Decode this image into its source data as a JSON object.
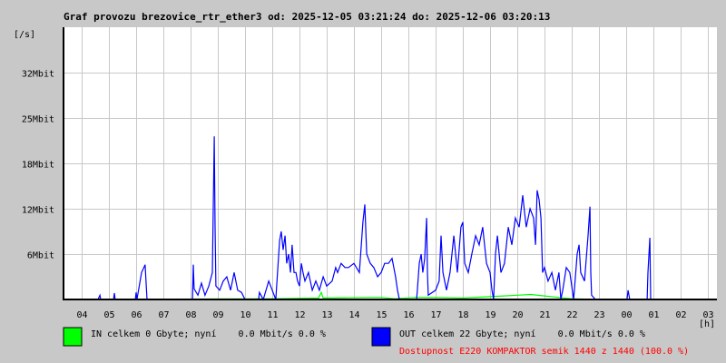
{
  "chart_data": {
    "type": "line",
    "title": "Graf provozu brezovice_rtr_ether3 od: 2025-12-05 03:21:24 do: 2025-12-06 03:20:13",
    "ylabel": "[/s]",
    "xlabel": "[h]",
    "ytick_labels": [
      "6Mbit",
      "12Mbit",
      "18Mbit",
      "25Mbit",
      "32Mbit"
    ],
    "ytick_values": [
      6.4,
      12.8,
      19.2,
      25.6,
      32.0
    ],
    "ylim": [
      0,
      38.4
    ],
    "xtick_labels": [
      "04",
      "05",
      "06",
      "07",
      "08",
      "09",
      "10",
      "11",
      "12",
      "13",
      "14",
      "15",
      "16",
      "17",
      "18",
      "19",
      "20",
      "21",
      "22",
      "23",
      "00",
      "01",
      "02",
      "03"
    ],
    "xtick_values": [
      4,
      5,
      6,
      7,
      8,
      9,
      10,
      11,
      12,
      13,
      14,
      15,
      16,
      17,
      18,
      19,
      20,
      21,
      22,
      23,
      24,
      25,
      26,
      27
    ],
    "xlim": [
      3.333,
      27.333
    ],
    "grid": true,
    "series": [
      {
        "name": "IN",
        "color": "#00ff00",
        "points": [
          [
            3.35,
            0
          ],
          [
            11,
            0.1
          ],
          [
            12.7,
            0.2
          ],
          [
            12.8,
            1.0
          ],
          [
            12.87,
            0.2
          ],
          [
            14.5,
            0.3
          ],
          [
            15,
            0.3
          ],
          [
            15.5,
            0.1
          ],
          [
            16.3,
            0.3
          ],
          [
            17,
            0.3
          ],
          [
            18,
            0.2
          ],
          [
            19,
            0.4
          ],
          [
            19.5,
            0.5
          ],
          [
            20,
            0.6
          ],
          [
            20.5,
            0.7
          ],
          [
            21,
            0.5
          ],
          [
            21.5,
            0.3
          ],
          [
            22,
            0.1
          ],
          [
            23,
            0
          ]
        ]
      },
      {
        "name": "OUT",
        "color": "#0000ff",
        "points": [
          [
            3.35,
            0
          ],
          [
            4.6,
            0
          ],
          [
            4.67,
            0.6
          ],
          [
            4.7,
            0
          ],
          [
            5.17,
            0
          ],
          [
            5.2,
            0.9
          ],
          [
            5.23,
            0
          ],
          [
            5.97,
            0
          ],
          [
            6.0,
            1.0
          ],
          [
            6.03,
            0
          ],
          [
            6.2,
            3.8
          ],
          [
            6.33,
            4.9
          ],
          [
            6.4,
            0
          ],
          [
            8.07,
            0
          ],
          [
            8.1,
            4.9
          ],
          [
            8.13,
            1.5
          ],
          [
            8.27,
            0.6
          ],
          [
            8.4,
            2.3
          ],
          [
            8.53,
            0.6
          ],
          [
            8.67,
            1.9
          ],
          [
            8.8,
            3.8
          ],
          [
            8.87,
            23.0
          ],
          [
            8.9,
            10.2
          ],
          [
            8.93,
            1.9
          ],
          [
            9.07,
            1.3
          ],
          [
            9.2,
            2.6
          ],
          [
            9.33,
            3.2
          ],
          [
            9.47,
            1.3
          ],
          [
            9.6,
            3.8
          ],
          [
            9.73,
            1.3
          ],
          [
            9.87,
            1.0
          ],
          [
            10.0,
            0
          ],
          [
            10.5,
            0
          ],
          [
            10.53,
            1.0
          ],
          [
            10.67,
            0
          ],
          [
            10.87,
            2.6
          ],
          [
            11.0,
            1.3
          ],
          [
            11.13,
            0
          ],
          [
            11.27,
            8.3
          ],
          [
            11.33,
            9.6
          ],
          [
            11.4,
            7.0
          ],
          [
            11.47,
            9.0
          ],
          [
            11.53,
            5.1
          ],
          [
            11.6,
            6.4
          ],
          [
            11.67,
            3.8
          ],
          [
            11.73,
            7.7
          ],
          [
            11.8,
            3.8
          ],
          [
            11.87,
            3.8
          ],
          [
            11.93,
            2.6
          ],
          [
            12.0,
            1.9
          ],
          [
            12.07,
            5.1
          ],
          [
            12.13,
            3.8
          ],
          [
            12.2,
            2.6
          ],
          [
            12.33,
            3.8
          ],
          [
            12.47,
            1.3
          ],
          [
            12.6,
            2.6
          ],
          [
            12.73,
            1.3
          ],
          [
            12.87,
            3.2
          ],
          [
            13.0,
            1.9
          ],
          [
            13.2,
            2.6
          ],
          [
            13.33,
            4.5
          ],
          [
            13.4,
            3.8
          ],
          [
            13.53,
            5.1
          ],
          [
            13.67,
            4.5
          ],
          [
            13.8,
            4.5
          ],
          [
            14.0,
            5.1
          ],
          [
            14.2,
            3.8
          ],
          [
            14.33,
            10.9
          ],
          [
            14.4,
            13.4
          ],
          [
            14.47,
            6.4
          ],
          [
            14.6,
            5.1
          ],
          [
            14.73,
            4.5
          ],
          [
            14.87,
            3.2
          ],
          [
            15.0,
            3.8
          ],
          [
            15.13,
            5.1
          ],
          [
            15.27,
            5.1
          ],
          [
            15.4,
            5.8
          ],
          [
            15.53,
            3.2
          ],
          [
            15.6,
            1.3
          ],
          [
            15.67,
            0
          ],
          [
            16.3,
            0
          ],
          [
            16.33,
            1.3
          ],
          [
            16.4,
            5.1
          ],
          [
            16.47,
            6.4
          ],
          [
            16.53,
            3.8
          ],
          [
            16.6,
            5.8
          ],
          [
            16.67,
            11.5
          ],
          [
            16.7,
            3.8
          ],
          [
            16.73,
            0.6
          ],
          [
            17.0,
            1.3
          ],
          [
            17.13,
            2.6
          ],
          [
            17.2,
            9.0
          ],
          [
            17.27,
            3.8
          ],
          [
            17.4,
            1.3
          ],
          [
            17.53,
            3.8
          ],
          [
            17.6,
            6.4
          ],
          [
            17.67,
            9.0
          ],
          [
            17.8,
            3.8
          ],
          [
            17.93,
            10.2
          ],
          [
            18.0,
            10.9
          ],
          [
            18.07,
            5.1
          ],
          [
            18.2,
            3.8
          ],
          [
            18.33,
            6.4
          ],
          [
            18.47,
            9.0
          ],
          [
            18.6,
            7.7
          ],
          [
            18.73,
            10.2
          ],
          [
            18.87,
            5.1
          ],
          [
            19.0,
            3.8
          ],
          [
            19.07,
            1.3
          ],
          [
            19.13,
            0
          ],
          [
            19.2,
            6.4
          ],
          [
            19.27,
            9.0
          ],
          [
            19.4,
            3.8
          ],
          [
            19.53,
            5.1
          ],
          [
            19.67,
            10.2
          ],
          [
            19.8,
            7.7
          ],
          [
            19.93,
            11.5
          ],
          [
            20.07,
            10.2
          ],
          [
            20.2,
            14.7
          ],
          [
            20.27,
            12.2
          ],
          [
            20.33,
            10.2
          ],
          [
            20.47,
            12.8
          ],
          [
            20.6,
            11.5
          ],
          [
            20.67,
            7.7
          ],
          [
            20.73,
            15.4
          ],
          [
            20.8,
            14.1
          ],
          [
            20.87,
            11.5
          ],
          [
            20.93,
            3.8
          ],
          [
            21.0,
            4.5
          ],
          [
            21.13,
            2.6
          ],
          [
            21.27,
            3.8
          ],
          [
            21.4,
            1.3
          ],
          [
            21.53,
            3.8
          ],
          [
            21.6,
            0
          ],
          [
            21.67,
            1.3
          ],
          [
            21.8,
            4.5
          ],
          [
            21.93,
            3.8
          ],
          [
            22.07,
            0
          ],
          [
            22.2,
            6.4
          ],
          [
            22.27,
            7.7
          ],
          [
            22.33,
            3.8
          ],
          [
            22.47,
            2.6
          ],
          [
            22.6,
            9.0
          ],
          [
            22.67,
            13.1
          ],
          [
            22.7,
            3.8
          ],
          [
            22.73,
            0.6
          ],
          [
            22.87,
            0
          ],
          [
            24.03,
            0
          ],
          [
            24.07,
            1.3
          ],
          [
            24.13,
            0
          ],
          [
            24.77,
            0
          ],
          [
            24.8,
            3.8
          ],
          [
            24.87,
            8.7
          ],
          [
            24.9,
            0
          ]
        ]
      }
    ]
  },
  "legend": {
    "in_text": "IN celkem 0 Gbyte; nyní    0.0 Mbit/s 0.0 %",
    "out_text": "OUT celkem 22 Gbyte; nyní    0.0 Mbit/s 0.0 %",
    "availability": "Dostupnost E220 KOMPAKTOR semik 1440 z 1440 (100.0 %)",
    "in_color": "#00ff00",
    "out_color": "#0000ff",
    "availability_color": "#ff0000"
  }
}
